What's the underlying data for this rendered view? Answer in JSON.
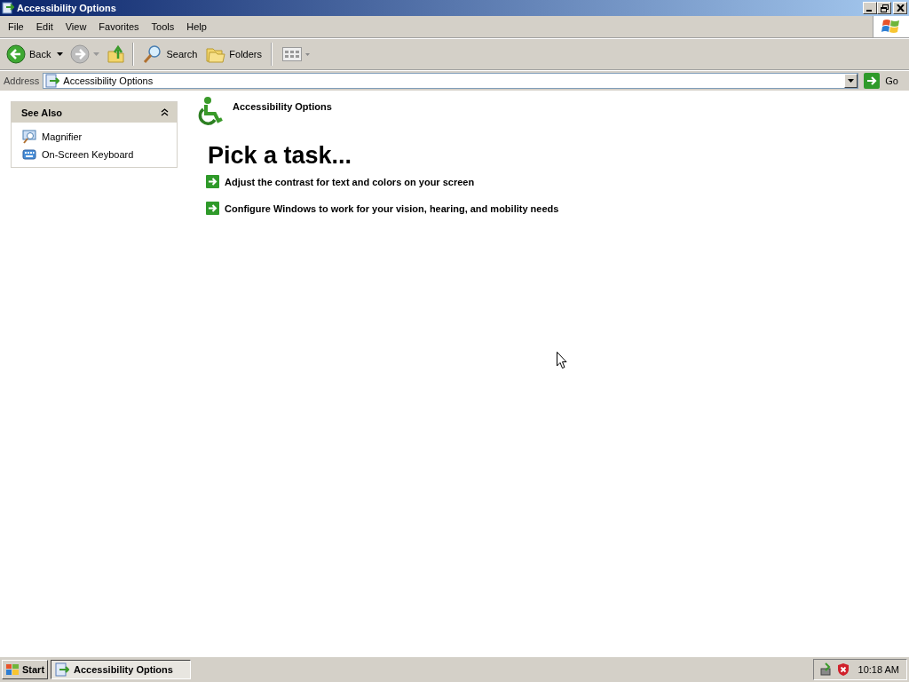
{
  "window": {
    "title": "Accessibility Options"
  },
  "menu": [
    "File",
    "Edit",
    "View",
    "Favorites",
    "Tools",
    "Help"
  ],
  "toolbar": {
    "back": "Back",
    "search": "Search",
    "folders": "Folders"
  },
  "address": {
    "label": "Address",
    "value": "Accessibility Options",
    "go": "Go"
  },
  "see_also": {
    "title": "See Also",
    "expanded": true,
    "items": [
      {
        "kind": "magnifier",
        "label": "Magnifier"
      },
      {
        "kind": "keyboard",
        "label": "On-Screen Keyboard"
      }
    ]
  },
  "header": "Accessibility Options",
  "heading": "Pick a task...",
  "tasks": [
    "Adjust the contrast for text and colors on your screen",
    "Configure Windows to work for your vision, hearing, and mobility needs"
  ],
  "taskbar": {
    "start": "Start",
    "buttons": [
      {
        "label": "Accessibility Options",
        "selected": true
      }
    ],
    "clock": "10:18 AM"
  }
}
